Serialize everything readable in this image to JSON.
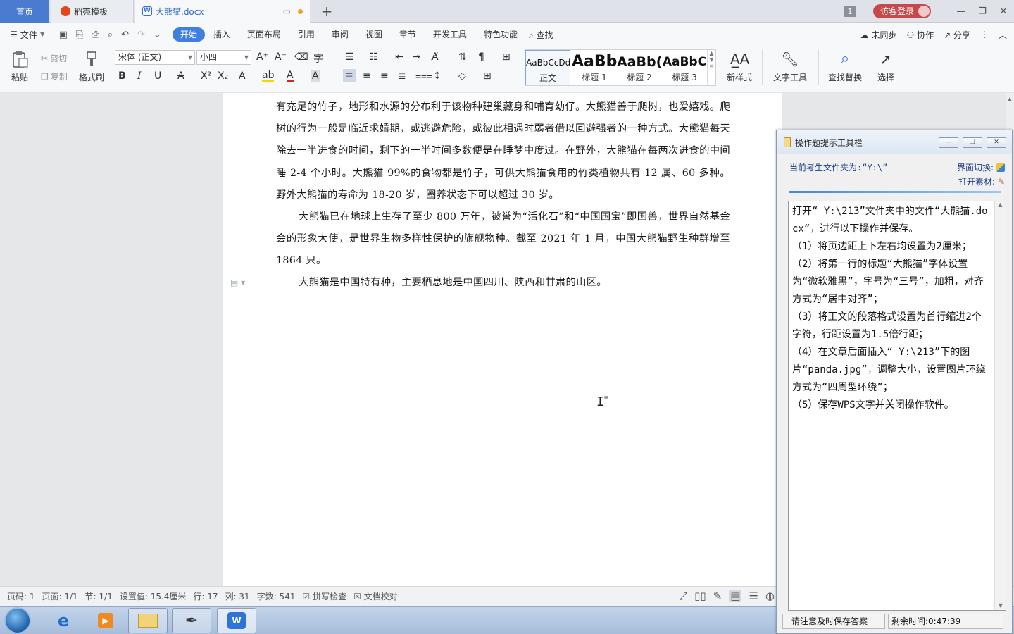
{
  "tabs": {
    "home": "首页",
    "docer": "稻壳模板",
    "document": "大熊猫.docx",
    "add": "+"
  },
  "top_right": {
    "badge": "1",
    "login": "访客登录"
  },
  "menu": {
    "file": "文件",
    "tabs": [
      "开始",
      "插入",
      "页面布局",
      "引用",
      "审阅",
      "视图",
      "章节",
      "开发工具",
      "特色功能"
    ],
    "search": "查找",
    "sync": "未同步",
    "collab": "协作",
    "share": "分享"
  },
  "ribbon": {
    "paste": "粘贴",
    "cut": "剪切",
    "copy": "复制",
    "format_painter": "格式刷",
    "font_name": "宋体 (正文)",
    "font_size": "小四",
    "bold": "B",
    "italic": "I",
    "underline": "U",
    "styles": [
      {
        "preview": "AaBbCcDd",
        "name": "正文"
      },
      {
        "preview": "AaBb",
        "name": "标题 1"
      },
      {
        "preview": "AaBb(",
        "name": "标题 2"
      },
      {
        "preview": "AaBbC",
        "name": "标题 3"
      }
    ],
    "new_style": "新样式",
    "text_tools": "文字工具",
    "find_replace": "查找替换",
    "select": "选择"
  },
  "document": {
    "paragraphs": [
      "有充足的竹子，地形和水源的分布利于该物种建巢藏身和哺育幼仔。大熊猫善于爬树，也爱嬉戏。爬树的行为一般是临近求婚期，或逃避危险，或彼此相遇时弱者借以回避强者的一种方式。大熊猫每天除去一半进食的时间，剩下的一半时间多数便是在睡梦中度过。在野外，大熊猫在每两次进食的中间睡 2-4 个小时。大熊猫 99%的食物都是竹子，可供大熊猫食用的竹类植物共有 12 属、60 多种。野外大熊猫的寿命为 18-20 岁，圈养状态下可以超过 30 岁。",
      "大熊猫已在地球上生存了至少 800 万年，被誉为“活化石”和“中国国宝”即国兽，世界自然基金会的形象大使，是世界生物多样性保护的旗舰物种。截至 2021 年 1 月，中国大熊猫野生种群增至 1864 只。",
      "大熊猫是中国特有种，主要栖息地是中国四川、陕西和甘肃的山区。"
    ]
  },
  "status": {
    "page_num": "页码: 1",
    "pages": "页面: 1/1",
    "section": "节: 1/1",
    "setting": "设置值: 15.4厘米",
    "row": "行: 17",
    "col": "列: 31",
    "words": "字数: 541",
    "spell": "拼写检查",
    "proof": "文档校对"
  },
  "helper": {
    "title": "操作题提示工具栏",
    "folder": "当前考生文件夹为:“Y:\\”",
    "switch": "界面切换:",
    "open": "打开素材:",
    "instructions": "打开“ Y:\\213”文件夹中的文件“大熊猫.docx”，进行以下操作并保存。\n（1）将页边距上下左右均设置为2厘米；\n（2）将第一行的标题“大熊猫”字体设置为“微软雅黑”，字号为“三号”，加粗，对齐方式为“居中对齐”；\n（3）将正文的段落格式设置为首行缩进2个字符，行距设置为1.5倍行距；\n（4）在文章后面插入“ Y:\\213”下的图片“panda.jpg”，调整大小，设置图片环绕方式为“四周型环绕”；\n（5）保存WPS文字并关闭操作软件。",
    "save_reminder": "请注意及时保存答案",
    "remaining": "剩余时间:0:47:39"
  },
  "colors": {
    "accent": "#3e7fe0",
    "home_tab": "#4a7bd0",
    "login": "#c8474a"
  }
}
